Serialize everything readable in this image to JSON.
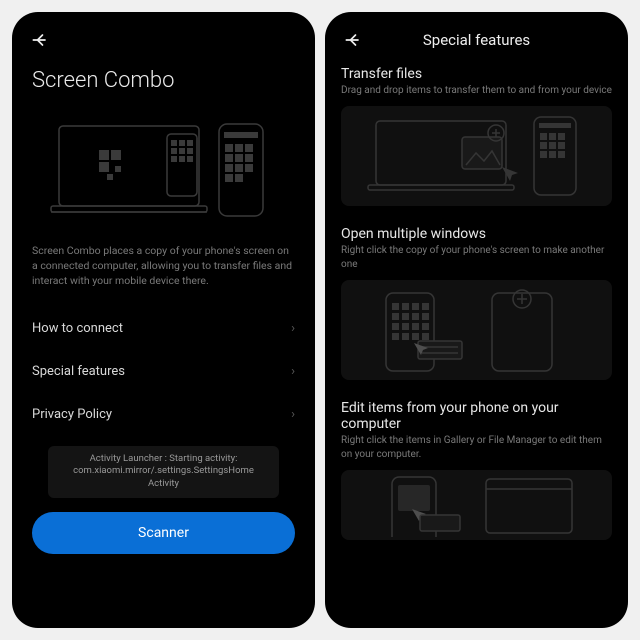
{
  "left": {
    "title": "Screen Combo",
    "description": "Screen Combo places a copy of your phone's screen on a connected computer, allowing you to transfer files and interact with your mobile device there.",
    "menu": [
      {
        "label": "How to connect"
      },
      {
        "label": "Special features"
      },
      {
        "label": "Privacy Policy"
      }
    ],
    "toast": "Activity Launcher : Starting activity: com.xiaomi.mirror/.settings.SettingsHome Activity",
    "scanner_label": "Scanner"
  },
  "right": {
    "header_title": "Special features",
    "sections": [
      {
        "title": "Transfer files",
        "subtitle": "Drag and drop items to transfer them to and from your device"
      },
      {
        "title": "Open multiple windows",
        "subtitle": "Right click the copy of your phone's screen to make another one"
      },
      {
        "title": "Edit items from your phone on your computer",
        "subtitle": "Right click the items in Gallery or File Manager to edit them on your computer."
      }
    ]
  }
}
